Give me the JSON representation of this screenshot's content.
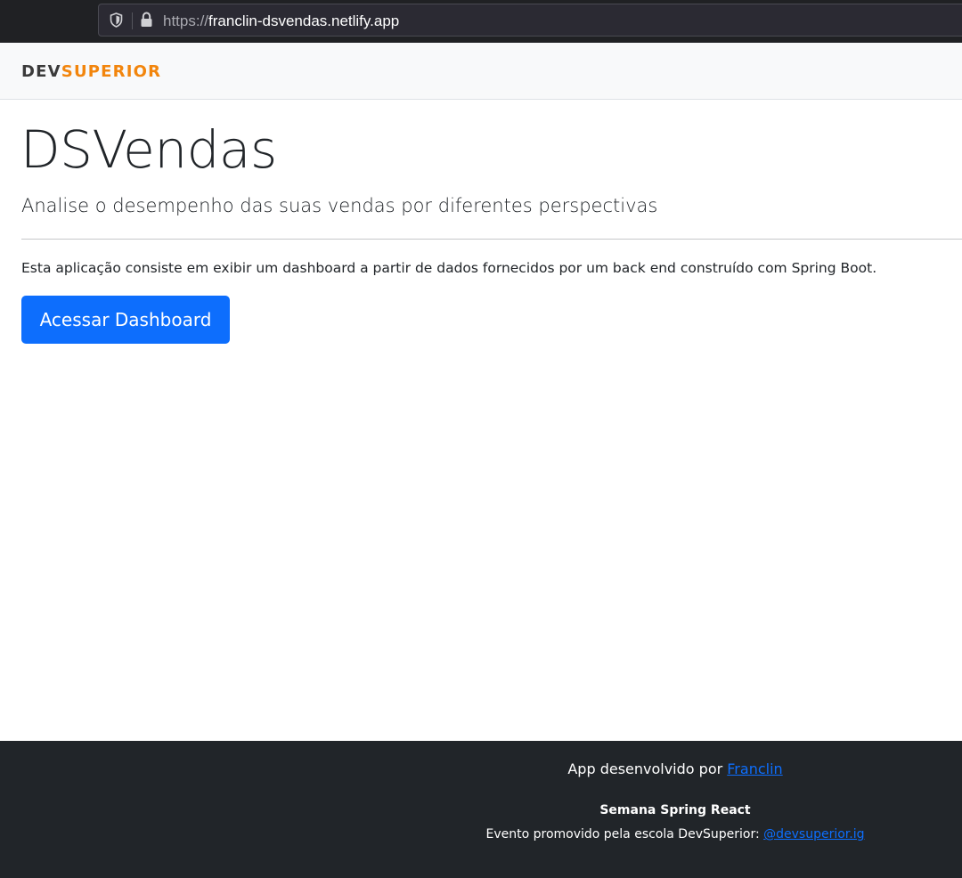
{
  "browser": {
    "url_scheme": "https://",
    "url_host": "franclin-dsvendas.netlify.app"
  },
  "navbar": {
    "logo_dev": "DEV",
    "logo_superior": "SUPERIOR",
    "logo_accent_color": "#f2850c"
  },
  "main": {
    "title": "DSVendas",
    "lead": "Analise o desempenho das suas vendas por diferentes perspectivas",
    "description": "Esta aplicação consiste em exibir um dashboard a partir de dados fornecidos por um back end construído com Spring Boot.",
    "cta_label": "Acessar Dashboard",
    "cta_color": "#0d6efd"
  },
  "footer": {
    "credit_prefix": "App desenvolvido por ",
    "credit_link": "Franclin",
    "event_title": "Semana Spring React",
    "event_prefix": "Evento promovido pela escola DevSuperior: ",
    "event_link": "@devsuperior.ig",
    "background_color": "#212529",
    "link_color": "#0d6efd"
  }
}
